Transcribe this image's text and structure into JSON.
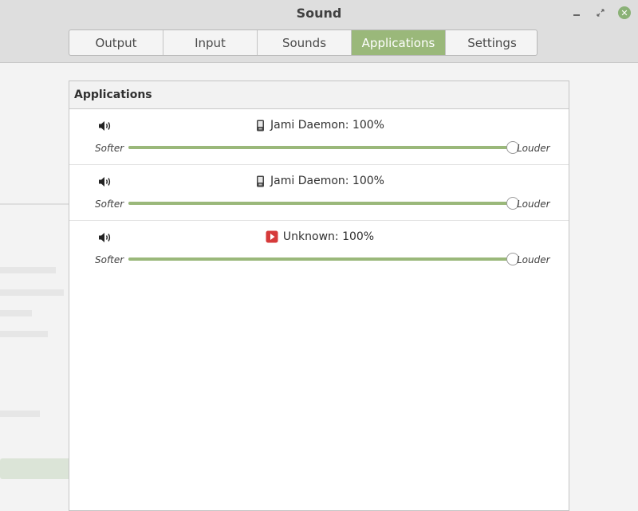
{
  "window": {
    "title": "Sound",
    "controls": {
      "minimize": "minimize-icon",
      "maximize": "maximize-icon",
      "close": "close-icon"
    }
  },
  "tabs": [
    {
      "label": "Output",
      "active": false
    },
    {
      "label": "Input",
      "active": false
    },
    {
      "label": "Sounds",
      "active": false
    },
    {
      "label": "Applications",
      "active": true
    },
    {
      "label": "Settings",
      "active": false
    }
  ],
  "panel": {
    "title": "Applications",
    "softer_label": "Softer",
    "louder_label": "Louder",
    "apps": [
      {
        "label": "Jami Daemon: 100%",
        "icon": "phone-icon",
        "volume": 1.0
      },
      {
        "label": "Jami Daemon: 100%",
        "icon": "phone-icon",
        "volume": 1.0
      },
      {
        "label": "Unknown: 100%",
        "icon": "media-play-icon",
        "volume": 1.0
      }
    ]
  },
  "colors": {
    "accent": "#9ab87a",
    "close_button": "#8ab176",
    "unknown_icon": "#d63a3a"
  }
}
